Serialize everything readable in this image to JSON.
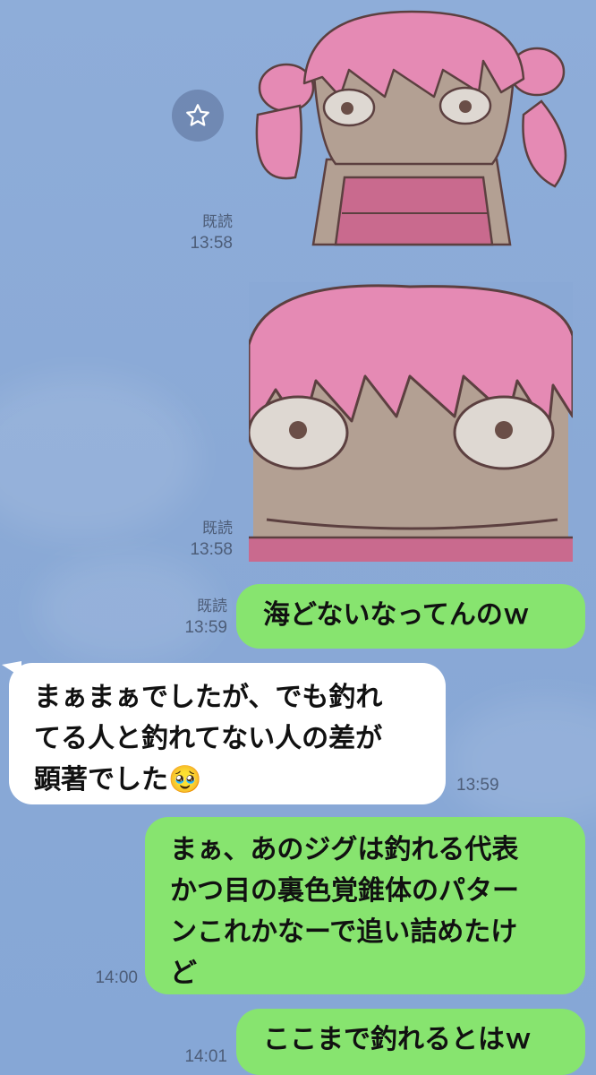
{
  "colors": {
    "background": "#8aa9d6",
    "my_bubble": "#87e46f",
    "their_bubble": "#ffffff",
    "meta_text": "#4d5d78"
  },
  "icons": {
    "star": "star-icon"
  },
  "messages": [
    {
      "type": "sticker",
      "sender": "me",
      "read_label": "既読",
      "time": "13:58",
      "sticker": "pink-girl-staring-sticker"
    },
    {
      "type": "image",
      "sender": "me",
      "read_label": "既読",
      "time": "13:58",
      "image": "pink-girl-closeup-image"
    },
    {
      "type": "text",
      "sender": "me",
      "read_label": "既読",
      "time": "13:59",
      "lines": [
        "海どないなってんのｗ"
      ]
    },
    {
      "type": "text",
      "sender": "them",
      "time": "13:59",
      "lines": [
        "まぁまぁでしたが、でも釣れ",
        "てる人と釣れてない人の差が",
        "顕著でした🥹"
      ]
    },
    {
      "type": "text",
      "sender": "me",
      "time": "14:00",
      "lines": [
        "まぁ、あのジグは釣れる代表",
        "かつ目の裏色覚錐体のパター",
        "ンこれかなーで追い詰めたけ",
        "ど"
      ]
    },
    {
      "type": "text",
      "sender": "me",
      "time": "14:01",
      "lines": [
        "ここまで釣れるとはｗ"
      ]
    }
  ]
}
